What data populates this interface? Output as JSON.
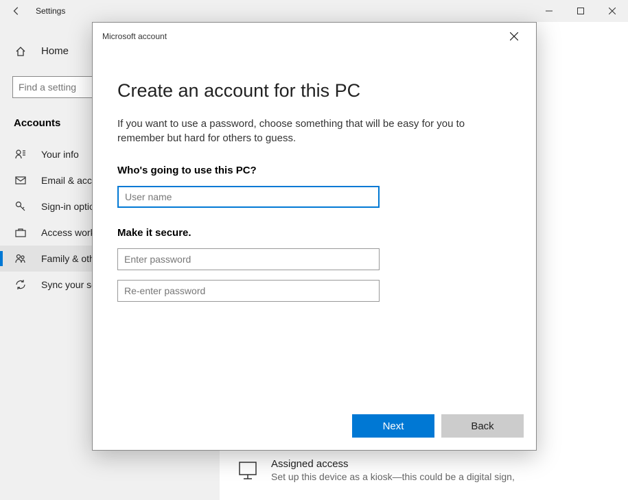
{
  "titlebar": {
    "title": "Settings"
  },
  "sidebar": {
    "home_label": "Home",
    "search_placeholder": "Find a setting",
    "category": "Accounts",
    "items": [
      {
        "label": "Your info"
      },
      {
        "label": "Email & accounts"
      },
      {
        "label": "Sign-in options"
      },
      {
        "label": "Access work or school"
      },
      {
        "label": "Family & other users"
      },
      {
        "label": "Sync your settings"
      }
    ]
  },
  "content": {
    "assigned": {
      "title": "Assigned access",
      "desc": "Set up this device as a kiosk—this could be a digital sign,"
    }
  },
  "dialog": {
    "header": "Microsoft account",
    "heading": "Create an account for this PC",
    "intro": "If you want to use a password, choose something that will be easy for you to remember but hard for others to guess.",
    "label_who": "Who's going to use this PC?",
    "placeholder_username": "User name",
    "label_secure": "Make it secure.",
    "placeholder_password": "Enter password",
    "placeholder_password2": "Re-enter password",
    "btn_next": "Next",
    "btn_back": "Back"
  }
}
